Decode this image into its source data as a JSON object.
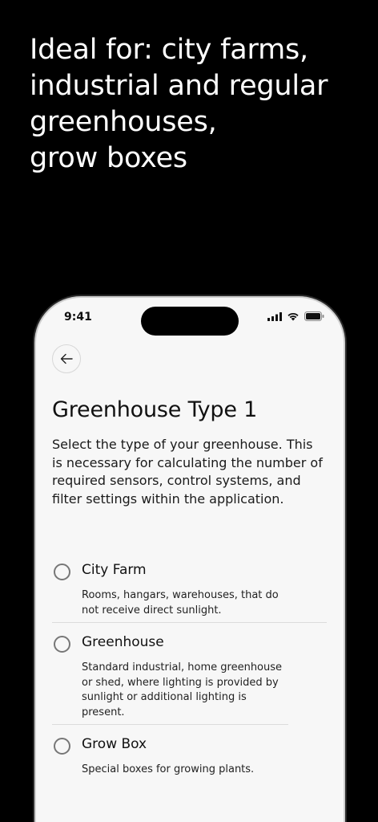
{
  "headline": "Ideal for: city farms,\nindustrial and regular\n greenhouses,\ngrow boxes",
  "status_bar": {
    "time": "9:41",
    "icons": [
      "signal-icon",
      "wifi-icon",
      "battery-icon"
    ]
  },
  "back_button_icon": "arrow-left-icon",
  "screen": {
    "title": "Greenhouse Type 1",
    "description": "Select the type of your greenhouse. This is necessary for calculating the number of required sensors, control systems, and filter settings within the application."
  },
  "options": [
    {
      "label": "City Farm",
      "description": "Rooms, hangars, warehouses, that do not receive direct sunlight.",
      "selected": false
    },
    {
      "label": "Greenhouse",
      "description": "Standard industrial, home greenhouse or shed, where lighting is provided by sunlight or additional lighting is present.",
      "selected": false
    },
    {
      "label": "Grow Box",
      "description": "Special boxes for growing plants.",
      "selected": false
    }
  ],
  "colors": {
    "background": "#000000",
    "phone_screen": "#f7f7f7",
    "text": "#111111",
    "radio_border": "#777777"
  }
}
